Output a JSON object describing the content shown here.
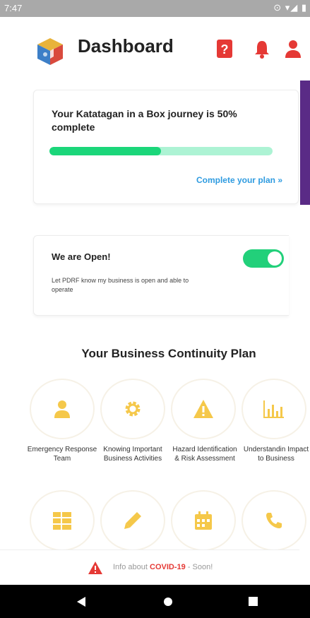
{
  "status_bar": {
    "time": "7:47",
    "icons": "⊙ ▾◢ ▮"
  },
  "header": {
    "title": "Dashboard",
    "icons": [
      "help-icon",
      "bell-icon",
      "user-icon"
    ],
    "accent_color": "#e53935"
  },
  "progress_card": {
    "title": "Your Katatagan in a Box journey is 50% complete",
    "progress_fraction": 0.5,
    "link_label": "Complete your plan »",
    "fill_color": "#1bd67a",
    "track_color": "#adf3d4"
  },
  "open_card": {
    "title": "We are Open!",
    "description": "Let PDRF know my business is open and able to operate",
    "toggle_on": true
  },
  "plan": {
    "title": "Your Business Continuity Plan",
    "items": [
      {
        "label": "Emergency Response Team",
        "icon": "person-icon"
      },
      {
        "label": "Knowing Important Business Activities",
        "icon": "gear-icon"
      },
      {
        "label": "Hazard Identification & Risk Assessment",
        "icon": "warning-icon"
      },
      {
        "label": "Understandin Impact to Business",
        "icon": "bar-chart-icon"
      },
      {
        "label": "",
        "icon": "server-icon"
      },
      {
        "label": "",
        "icon": "pencil-icon"
      },
      {
        "label": "",
        "icon": "calendar-icon"
      },
      {
        "label": "",
        "icon": "phone-icon"
      }
    ],
    "icon_color": "#f5c84a"
  },
  "covid_bar": {
    "prefix": "Info about ",
    "highlight": "COVID-19",
    "suffix": " - Soon!"
  },
  "nav_bar": {
    "icons": [
      "back-icon",
      "home-icon",
      "recents-icon"
    ]
  }
}
